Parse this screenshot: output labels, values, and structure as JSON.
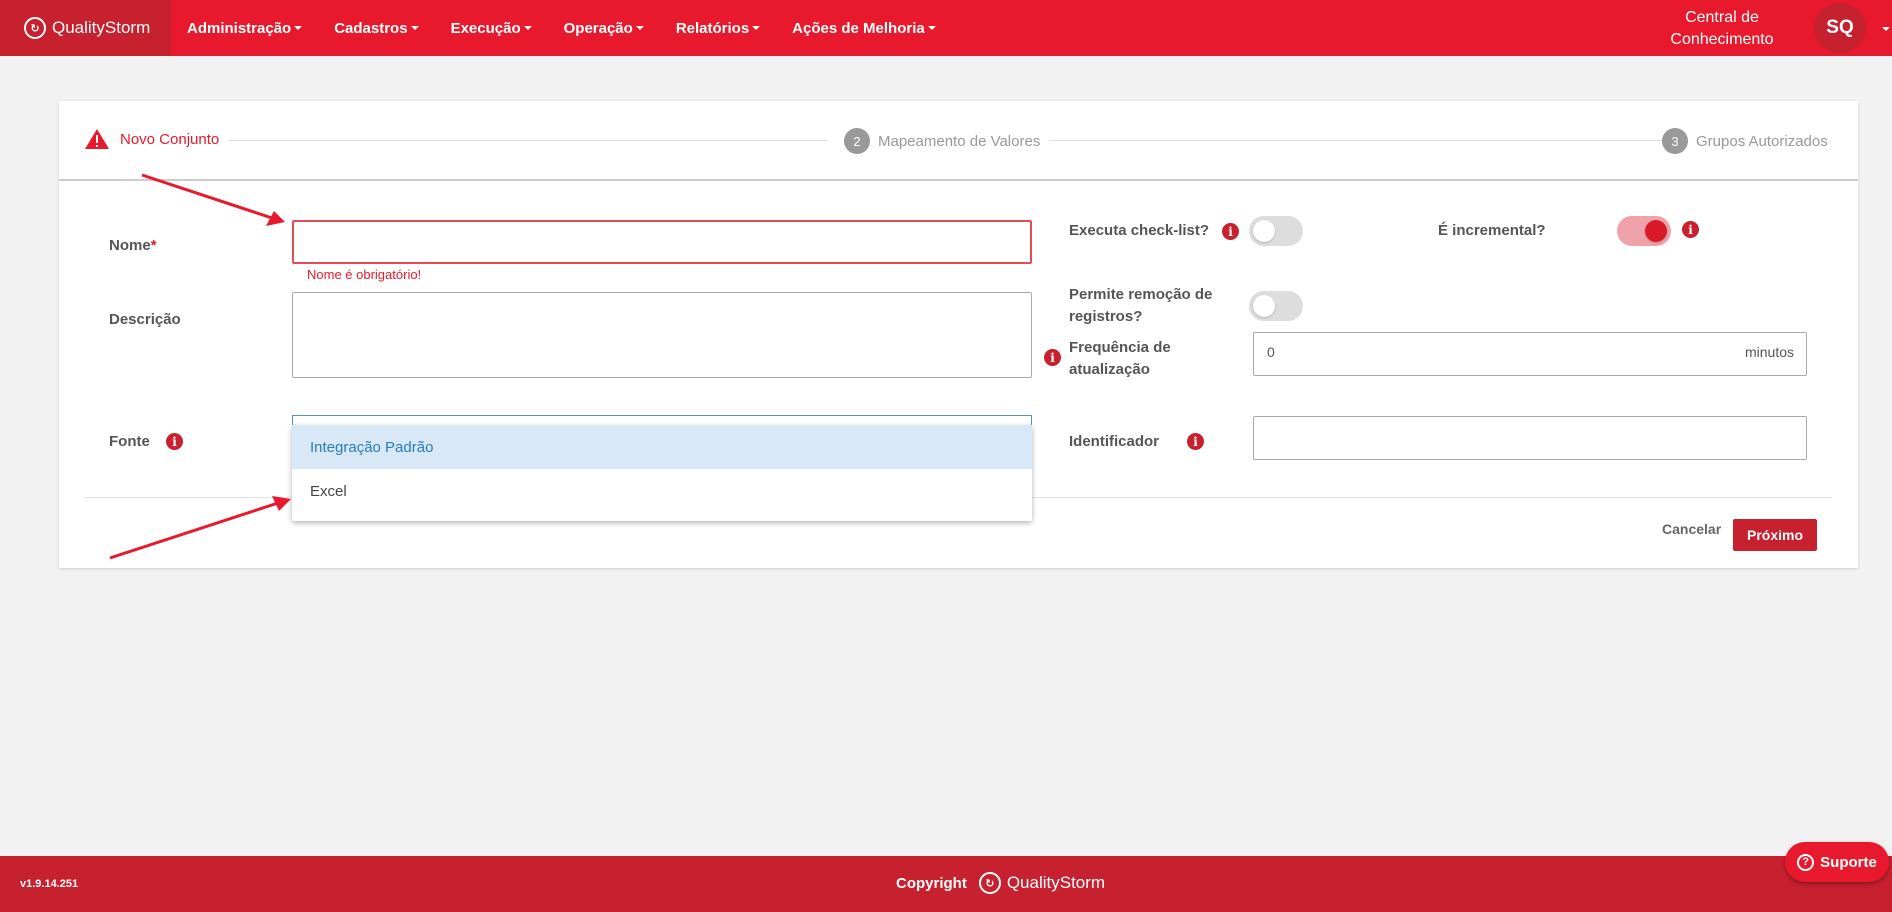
{
  "app": {
    "brand": "QualityStorm"
  },
  "nav": {
    "items": [
      {
        "label": "Administração"
      },
      {
        "label": "Cadastros"
      },
      {
        "label": "Execução"
      },
      {
        "label": "Operação"
      },
      {
        "label": "Relatórios"
      },
      {
        "label": "Ações de Melhoria"
      }
    ],
    "knowledge_center": "Central de Conhecimento",
    "avatar_initials": "SQ"
  },
  "stepper": {
    "steps": [
      {
        "label": "Novo Conjunto",
        "status": "error"
      },
      {
        "number": "2",
        "label": "Mapeamento de Valores"
      },
      {
        "number": "3",
        "label": "Grupos Autorizados"
      }
    ]
  },
  "form": {
    "nome_label": "Nome",
    "nome_required": "*",
    "nome_value": "",
    "nome_error": "Nome é obrigatório!",
    "descricao_label": "Descrição",
    "descricao_value": "",
    "fonte_label": "Fonte",
    "fonte_options": [
      "Integração Padrão",
      "Excel"
    ],
    "fonte_highlighted": "Integração Padrão",
    "executa_checklist_label": "Executa check-list?",
    "executa_checklist_on": false,
    "incremental_label": "É incremental?",
    "incremental_on": true,
    "permite_remocao_label": "Permite remoção de registros?",
    "permite_remocao_on": false,
    "frequencia_label": "Frequência de atualização",
    "frequencia_value": "0",
    "frequencia_unit": "minutos",
    "identificador_label": "Identificador",
    "identificador_value": "",
    "info_glyph": "i"
  },
  "actions": {
    "cancel": "Cancelar",
    "next": "Próximo"
  },
  "footer": {
    "version": "v1.9.14.251",
    "copyright": "Copyright",
    "brand": "QualityStorm",
    "support": "Suporte"
  },
  "colors": {
    "primary": "#e8192c",
    "dark": "#c7202f",
    "highlight": "#d8e8f6"
  }
}
